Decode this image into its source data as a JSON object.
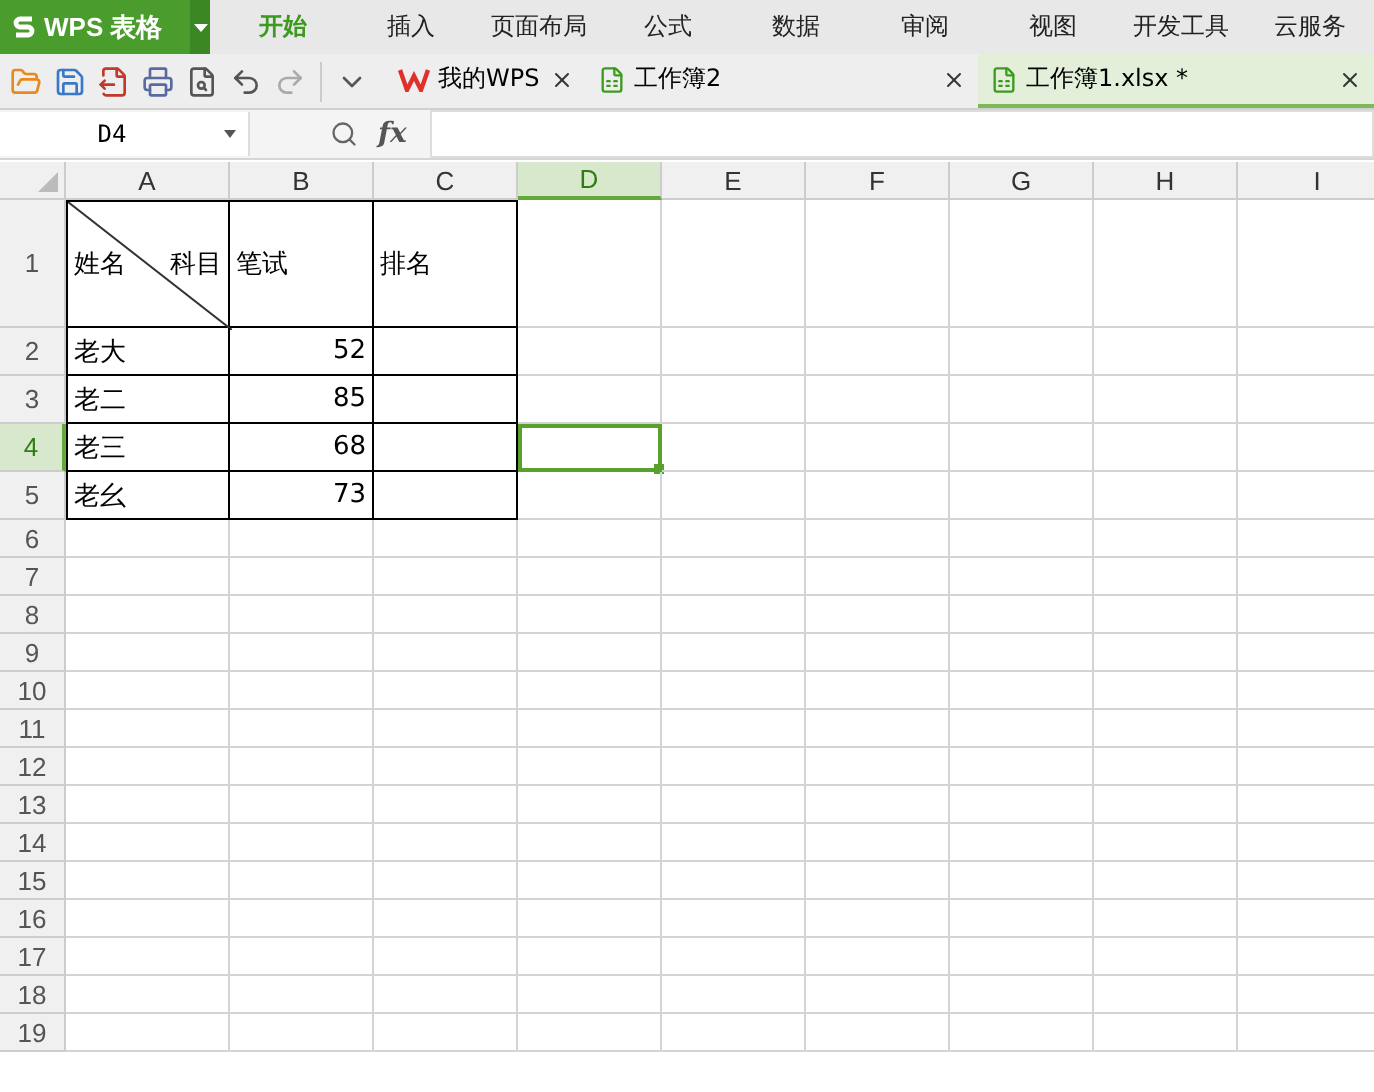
{
  "app_button": {
    "label": "WPS 表格"
  },
  "menu_tabs": [
    {
      "label": "开始",
      "selected": true
    },
    {
      "label": "插入",
      "selected": false
    },
    {
      "label": "页面布局",
      "selected": false
    },
    {
      "label": "公式",
      "selected": false
    },
    {
      "label": "数据",
      "selected": false
    },
    {
      "label": "审阅",
      "selected": false
    },
    {
      "label": "视图",
      "selected": false
    },
    {
      "label": "开发工具",
      "selected": false
    },
    {
      "label": "云服务",
      "selected": false
    }
  ],
  "doc_tabs": [
    {
      "label": "我的WPS",
      "kind": "home",
      "selected": false
    },
    {
      "label": "工作簿2",
      "kind": "sheet",
      "selected": false
    },
    {
      "label": "工作簿1.xlsx *",
      "kind": "sheet",
      "selected": true
    }
  ],
  "name_box": {
    "value": "D4"
  },
  "formula_bar": {
    "fx_label": "fx"
  },
  "columns": [
    {
      "label": "A",
      "selected": false
    },
    {
      "label": "B",
      "selected": false
    },
    {
      "label": "C",
      "selected": false
    },
    {
      "label": "D",
      "selected": true
    },
    {
      "label": "E",
      "selected": false
    },
    {
      "label": "F",
      "selected": false
    },
    {
      "label": "G",
      "selected": false
    },
    {
      "label": "H",
      "selected": false
    },
    {
      "label": "I",
      "selected": false
    }
  ],
  "rows": [
    {
      "label": "1",
      "selected": false,
      "cells": [
        {
          "kind": "diagonal",
          "left": "姓名",
          "right": "科目",
          "bordered": true,
          "selected": false
        },
        {
          "kind": "text",
          "text": "笔试",
          "bordered": true,
          "selected": false
        },
        {
          "kind": "text",
          "text": "排名",
          "bordered": true,
          "selected": false
        }
      ]
    },
    {
      "label": "2",
      "selected": false,
      "cells": [
        {
          "kind": "text",
          "text": "老大",
          "bordered": true,
          "selected": false
        },
        {
          "kind": "number",
          "text": "52",
          "bordered": true,
          "selected": false
        },
        {
          "kind": "text",
          "text": "",
          "bordered": true,
          "selected": false
        }
      ]
    },
    {
      "label": "3",
      "selected": false,
      "cells": [
        {
          "kind": "text",
          "text": "老二",
          "bordered": true,
          "selected": false
        },
        {
          "kind": "number",
          "text": "85",
          "bordered": true,
          "selected": false
        },
        {
          "kind": "text",
          "text": "",
          "bordered": true,
          "selected": false
        }
      ]
    },
    {
      "label": "4",
      "selected": true,
      "cells": [
        {
          "kind": "text",
          "text": "老三",
          "bordered": true,
          "selected": false
        },
        {
          "kind": "number",
          "text": "68",
          "bordered": true,
          "selected": false
        },
        {
          "kind": "text",
          "text": "",
          "bordered": true,
          "selected": false
        },
        {
          "kind": "text",
          "text": "",
          "bordered": false,
          "selected": true
        }
      ]
    },
    {
      "label": "5",
      "selected": false,
      "cells": [
        {
          "kind": "text",
          "text": "老幺",
          "bordered": true,
          "selected": false
        },
        {
          "kind": "number",
          "text": "73",
          "bordered": true,
          "selected": false
        },
        {
          "kind": "text",
          "text": "",
          "bordered": true,
          "selected": false
        }
      ]
    },
    {
      "label": "6",
      "selected": false,
      "cells": []
    },
    {
      "label": "7",
      "selected": false,
      "cells": []
    },
    {
      "label": "8",
      "selected": false,
      "cells": []
    },
    {
      "label": "9",
      "selected": false,
      "cells": []
    },
    {
      "label": "10",
      "selected": false,
      "cells": []
    },
    {
      "label": "11",
      "selected": false,
      "cells": []
    },
    {
      "label": "12",
      "selected": false,
      "cells": []
    },
    {
      "label": "13",
      "selected": false,
      "cells": []
    },
    {
      "label": "14",
      "selected": false,
      "cells": []
    },
    {
      "label": "15",
      "selected": false,
      "cells": []
    },
    {
      "label": "16",
      "selected": false,
      "cells": []
    },
    {
      "label": "17",
      "selected": false,
      "cells": []
    },
    {
      "label": "18",
      "selected": false,
      "cells": []
    },
    {
      "label": "19",
      "selected": false,
      "cells": []
    }
  ]
}
